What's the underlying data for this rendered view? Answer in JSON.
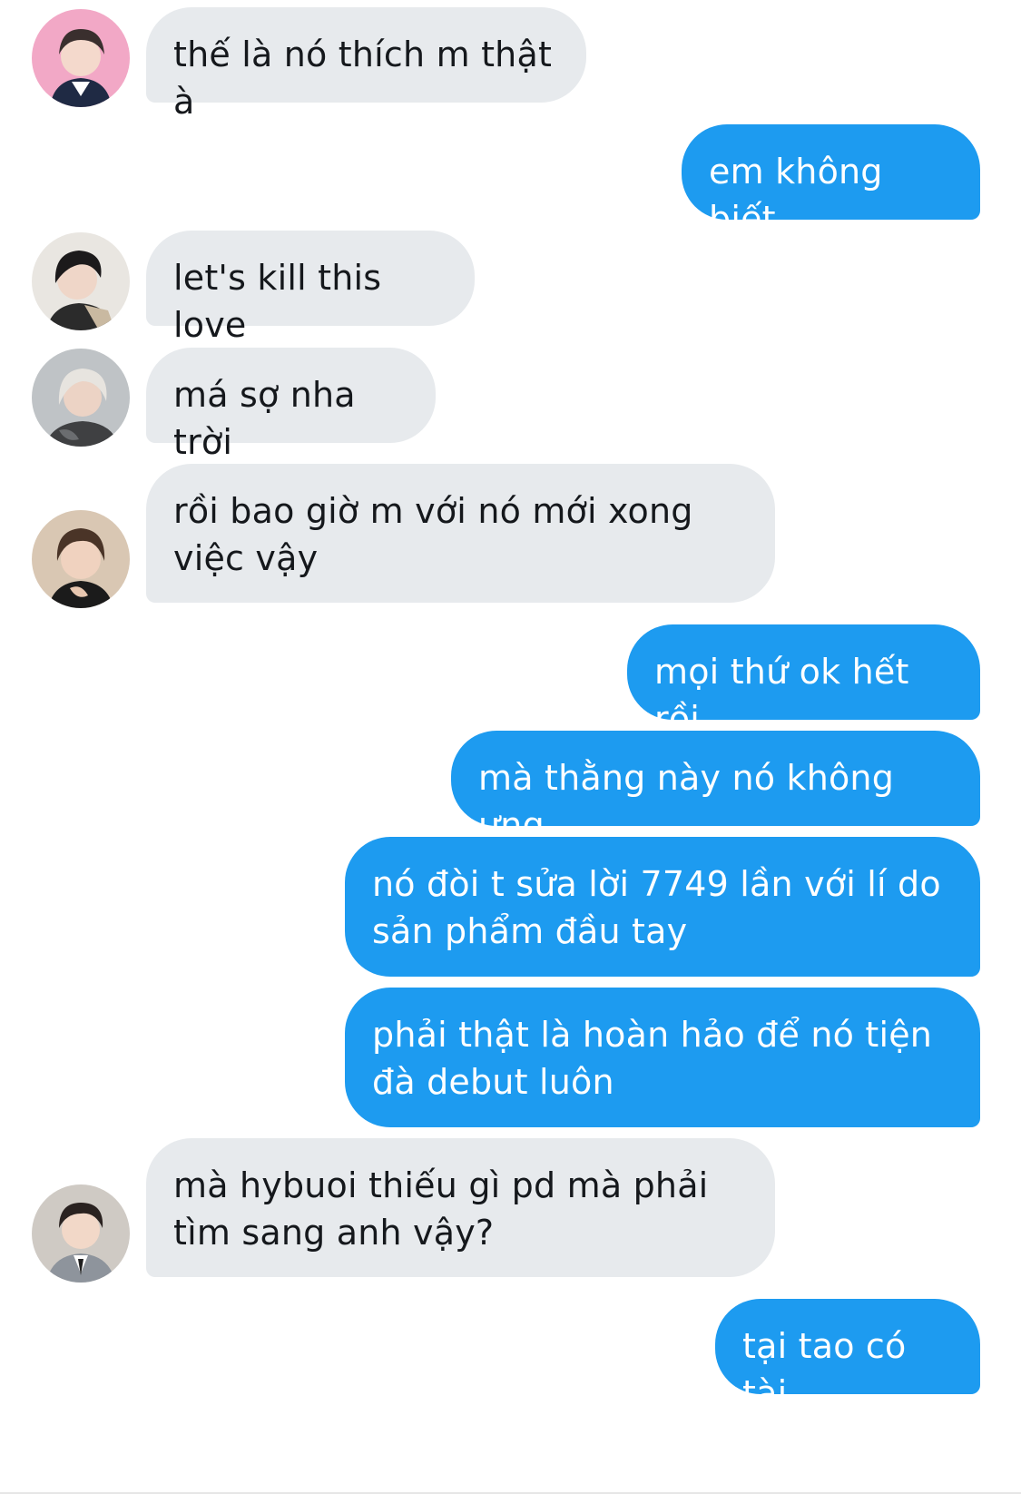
{
  "conversation": {
    "messages": [
      {
        "text": "thế là nó thích m thật à"
      },
      {
        "text": "em không biết"
      },
      {
        "text": "let's kill this love"
      },
      {
        "text": "má sợ nha trời"
      },
      {
        "text": "rồi bao giờ m với nó mới xong việc vậy"
      },
      {
        "text": "mọi thứ ok hết rồi"
      },
      {
        "text": "mà thằng này nó không ưng"
      },
      {
        "text": "nó đòi t sửa lời 7749 lần với lí do sản phẩm đầu tay"
      },
      {
        "text": "phải thật là hoàn hảo để nó tiện đà debut luôn"
      },
      {
        "text": "mà hybuoi thiếu gì pd mà phải tìm sang anh vậy?"
      },
      {
        "text": "tại tao có tài"
      }
    ]
  },
  "colors": {
    "incoming_bubble": "#e7eaed",
    "outgoing_bubble": "#1d9bf0",
    "incoming_text": "#15181c",
    "outgoing_text": "#ffffff"
  }
}
